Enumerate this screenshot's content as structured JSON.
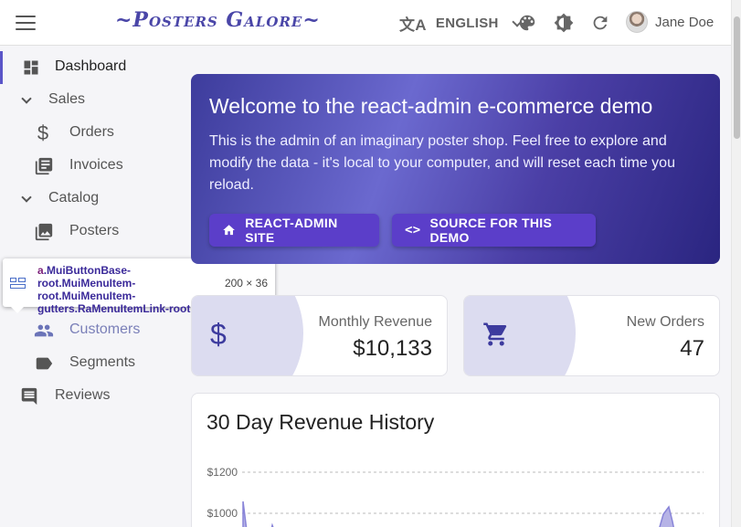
{
  "app": {
    "logo": "~Posters Galore~",
    "language": "ENGLISH",
    "user_name": "Jane Doe"
  },
  "sidebar": {
    "items": [
      {
        "label": "Dashboard",
        "icon": "dashboard-icon"
      },
      {
        "label": "Sales",
        "icon": "chevron-down-icon"
      },
      {
        "label": "Orders",
        "icon": "dollar-icon"
      },
      {
        "label": "Invoices",
        "icon": "invoices-icon"
      },
      {
        "label": "Catalog",
        "icon": "chevron-down-icon"
      },
      {
        "label": "Posters",
        "icon": "image-icon"
      },
      {
        "label": "Customers",
        "icon": "people-icon"
      },
      {
        "label": "Segments",
        "icon": "label-icon"
      },
      {
        "label": "Reviews",
        "icon": "comment-icon"
      }
    ]
  },
  "inspector": {
    "tag": "a",
    "classes": ".MuiButtonBase-root.MuiMenuItem-root.MuiMenuItem-gutters.RaMenuItemLink-root.cs...",
    "size": "200 × 36"
  },
  "welcome": {
    "title": "Welcome to the react-admin e-commerce demo",
    "body": "This is the admin of an imaginary poster shop. Feel free to explore and modify the data - it's local to your computer, and will reset each time you reload.",
    "button_site": "REACT-ADMIN SITE",
    "button_source": "SOURCE FOR THIS DEMO"
  },
  "stats": {
    "revenue_title": "Monthly Revenue",
    "revenue_value": "$10,133",
    "orders_title": "New Orders",
    "orders_value": "47"
  },
  "revenue_history": {
    "title": "30 Day Revenue History"
  },
  "chart_data": {
    "type": "area",
    "title": "30 Day Revenue History",
    "yticks": [
      "$1200",
      "$1000"
    ],
    "grid": true,
    "color": "#8884d8"
  },
  "colors": {
    "brand": "#4a46a8",
    "accent": "#5b3ec9",
    "highlight": "#c7ddb0"
  }
}
